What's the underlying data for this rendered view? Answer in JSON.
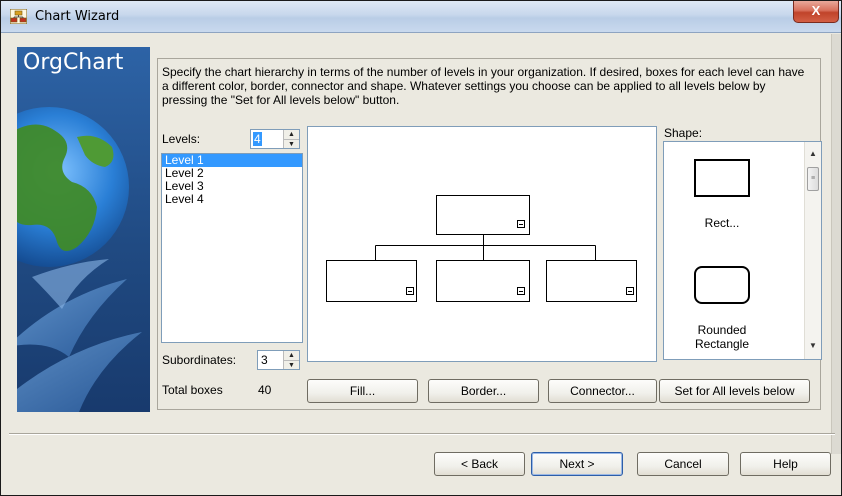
{
  "window": {
    "title": "Chart Wizard",
    "close_glyph": "X",
    "app_icon": "orgchart-app-icon"
  },
  "banner": {
    "title": "OrgChart"
  },
  "description": "Specify the chart hierarchy in terms of the number of levels in your organization.  If desired, boxes for each level can have a different color, border, connector and shape.  Whatever settings you choose can be applied to all levels below by pressing the \"Set for All levels below\" button.",
  "levels": {
    "label": "Levels:",
    "value": "4",
    "items": [
      "Level 1",
      "Level 2",
      "Level 3",
      "Level 4"
    ],
    "selected_index": 0
  },
  "subordinates": {
    "label": "Subordinates:",
    "value": "3"
  },
  "total_boxes": {
    "label": "Total boxes",
    "value": "40"
  },
  "shape": {
    "label": "Shape:",
    "options": [
      {
        "label": "Rect...",
        "icon": "rectangle-shape-icon"
      },
      {
        "label": "Rounded\nRectangle",
        "icon": "rounded-rectangle-shape-icon"
      }
    ]
  },
  "actions": {
    "fill": "Fill...",
    "border": "Border...",
    "connector": "Connector...",
    "set_all": "Set for All levels below"
  },
  "nav": {
    "back": "< Back",
    "next": "Next >",
    "cancel": "Cancel",
    "help": "Help"
  },
  "colors": {
    "selection": "#3399ff",
    "banner": "#204a82",
    "close": "#c0432a"
  }
}
